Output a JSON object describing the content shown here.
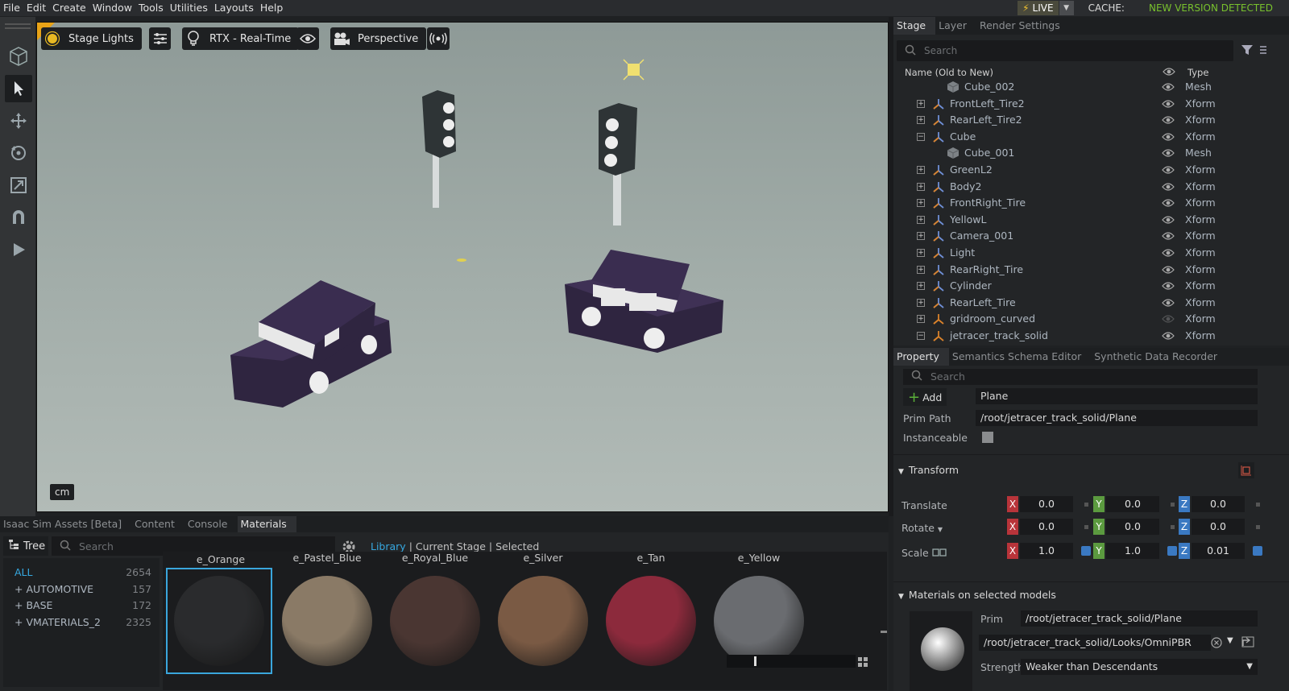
{
  "menu": [
    "File",
    "Edit",
    "Create",
    "Window",
    "Tools",
    "Utilities",
    "Layouts",
    "Help"
  ],
  "status": {
    "live": "LIVE",
    "cache": "CACHE:",
    "new_version": "NEW VERSION DETECTED"
  },
  "viewport": {
    "stage_lights": "Stage Lights",
    "render_mode": "RTX - Real-Time",
    "camera": "Perspective",
    "units": "cm"
  },
  "stage": {
    "tabs": [
      "Stage",
      "Layer",
      "Render Settings"
    ],
    "search_placeholder": "Search",
    "col_name": "Name (Old to New)",
    "col_type": "Type",
    "rows": [
      {
        "name": "Cube_002",
        "type": "Mesh"
      },
      {
        "name": "FrontLeft_Tire2",
        "type": "Xform"
      },
      {
        "name": "RearLeft_Tire2",
        "type": "Xform"
      },
      {
        "name": "Cube",
        "type": "Xform"
      },
      {
        "name": "Cube_001",
        "type": "Mesh"
      },
      {
        "name": "GreenL2",
        "type": "Xform"
      },
      {
        "name": "Body2",
        "type": "Xform"
      },
      {
        "name": "FrontRight_Tire",
        "type": "Xform"
      },
      {
        "name": "YellowL",
        "type": "Xform"
      },
      {
        "name": "Camera_001",
        "type": "Xform"
      },
      {
        "name": "Light",
        "type": "Xform"
      },
      {
        "name": "RearRight_Tire",
        "type": "Xform"
      },
      {
        "name": "Cylinder",
        "type": "Xform"
      },
      {
        "name": "RearLeft_Tire",
        "type": "Xform"
      },
      {
        "name": "gridroom_curved",
        "type": "Xform"
      },
      {
        "name": "jetracer_track_solid",
        "type": "Xform"
      }
    ]
  },
  "property": {
    "tabs": [
      "Property",
      "Semantics Schema Editor",
      "Synthetic Data Recorder"
    ],
    "search_placeholder": "Search",
    "add_label": "Add",
    "prim_name": "Plane",
    "prim_path_label": "Prim Path",
    "prim_path": "/root/jetracer_track_solid/Plane",
    "instanceable_label": "Instanceable",
    "transform_label": "Transform",
    "translate_label": "Translate",
    "rotate_label": "Rotate",
    "scale_label": "Scale",
    "axes": {
      "x": "X",
      "y": "Y",
      "z": "Z"
    },
    "translate": [
      "0.0",
      "0.0",
      "0.0"
    ],
    "rotate": [
      "0.0",
      "0.0",
      "0.0"
    ],
    "scale": [
      "1.0",
      "1.0",
      "0.01"
    ],
    "materials_label": "Materials on selected models",
    "prim_label": "Prim",
    "mat_prim": "/root/jetracer_track_solid/Plane",
    "mat_path": "/root/jetracer_track_solid/Looks/OmniPBR",
    "strength_label": "Strength",
    "strength_value": "Weaker than Descendants"
  },
  "bottom": {
    "tabs": [
      "Isaac Sim Assets [Beta]",
      "Content",
      "Console",
      "Materials"
    ],
    "tree_label": "Tree",
    "search_placeholder": "Search",
    "lib_tabs": [
      "Library",
      "Current Stage",
      "Selected"
    ],
    "categories": [
      {
        "name": "ALL",
        "count": "2654"
      },
      {
        "name": "AUTOMOTIVE",
        "count": "157"
      },
      {
        "name": "BASE",
        "count": "172"
      },
      {
        "name": "VMATERIALS_2",
        "count": "2325"
      }
    ],
    "swatches": [
      {
        "name": "e_Orange",
        "color": "#2a2b2d"
      },
      {
        "name": "e_Pastel_Blue",
        "color": "#8a7a66"
      },
      {
        "name": "e_Royal_Blue",
        "color": "#4a3632"
      },
      {
        "name": "e_Silver",
        "color": "#7a5a44"
      },
      {
        "name": "e_Tan",
        "color": "#8c2a3c"
      },
      {
        "name": "e_Yellow",
        "color": "#6a6c70"
      }
    ]
  }
}
